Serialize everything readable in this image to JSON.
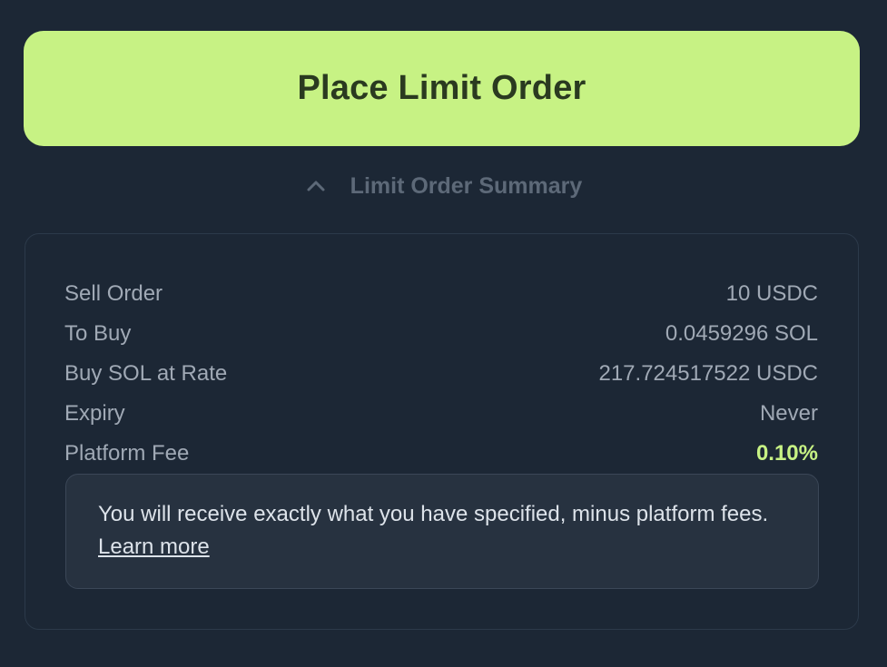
{
  "place_button": {
    "label": "Place Limit Order"
  },
  "summary": {
    "toggle_label": "Limit Order Summary",
    "rows": [
      {
        "label": "Sell Order",
        "value": "10 USDC"
      },
      {
        "label": "To Buy",
        "value": "0.0459296 SOL"
      },
      {
        "label": "Buy SOL at Rate",
        "value": "217.724517522 USDC"
      },
      {
        "label": "Expiry",
        "value": "Never"
      },
      {
        "label": "Platform Fee",
        "value": "0.10%"
      }
    ],
    "note": {
      "text": "You will receive exactly what you have specified, minus platform fees. ",
      "link_label": "Learn more"
    }
  },
  "colors": {
    "background": "#1c2735",
    "accent": "#c7f284",
    "muted_text": "#a0a9b5"
  },
  "icons": {
    "toggle": "chevron-up-icon"
  }
}
